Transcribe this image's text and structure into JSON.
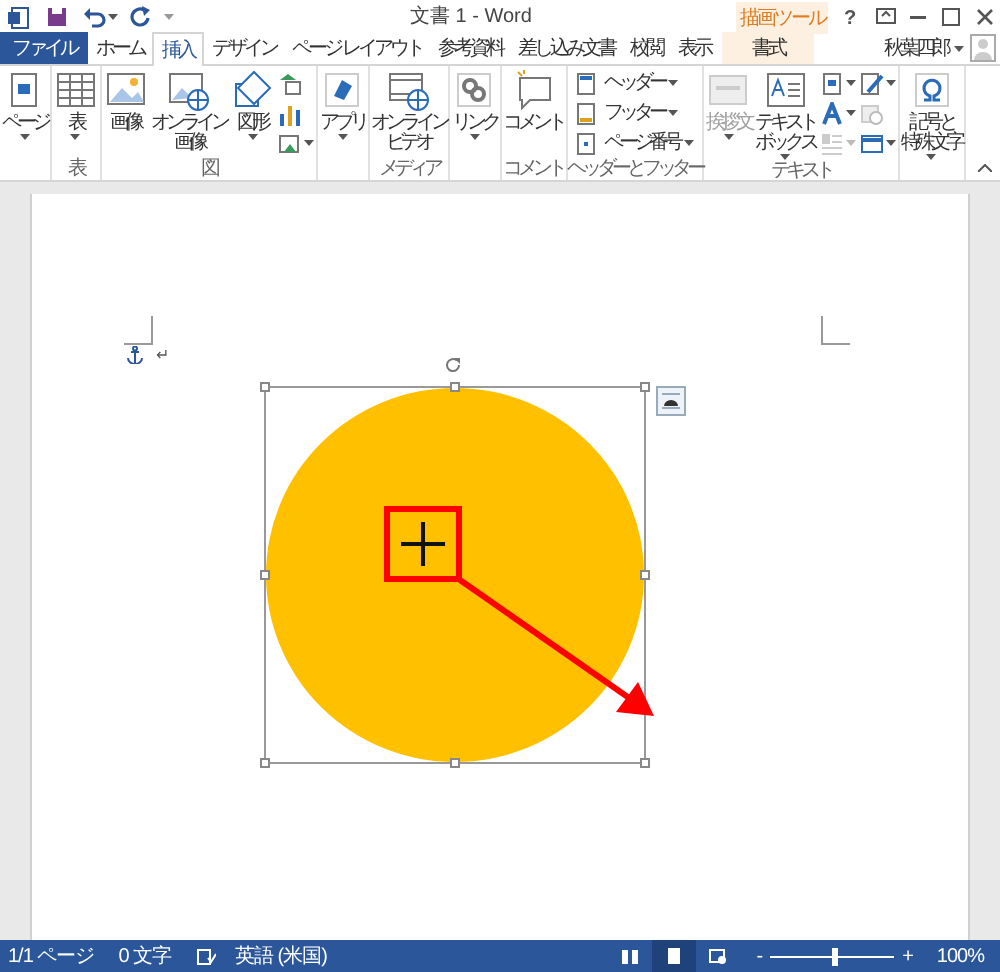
{
  "title_bar": {
    "title": "文書 1 - Word",
    "context_label": "描画ツール",
    "help": "?"
  },
  "tabs": [
    {
      "label": "ファイル",
      "kind": "file",
      "selected": false
    },
    {
      "label": "ホーム",
      "kind": "normal",
      "selected": false
    },
    {
      "label": "挿入",
      "kind": "normal",
      "selected": true
    },
    {
      "label": "デザイン",
      "kind": "normal",
      "selected": false
    },
    {
      "label": "ページ レイアウト",
      "kind": "normal",
      "selected": false
    },
    {
      "label": "参考資料",
      "kind": "normal",
      "selected": false
    },
    {
      "label": "差し込み文書",
      "kind": "normal",
      "selected": false
    },
    {
      "label": "校閲",
      "kind": "normal",
      "selected": false
    },
    {
      "label": "表示",
      "kind": "normal",
      "selected": false
    },
    {
      "label": "書式",
      "kind": "context",
      "selected": false
    }
  ],
  "user": {
    "name": "秋葉四郎"
  },
  "ribbon": {
    "groups": [
      {
        "buttons": [
          {
            "kind": "large",
            "label": "ページ",
            "menu": true,
            "disabled": false
          }
        ]
      },
      {
        "label": "表",
        "buttons": [
          {
            "kind": "large",
            "label": "表",
            "menu": true,
            "disabled": false
          }
        ]
      },
      {
        "label": "図",
        "buttons": [
          {
            "kind": "large",
            "label": "画像",
            "menu": false,
            "disabled": false
          },
          {
            "kind": "large",
            "label": "オンライン画像",
            "menu": false,
            "disabled": false
          },
          {
            "kind": "large",
            "label": "図形",
            "menu": true,
            "disabled": false
          },
          {
            "kind": "column",
            "items": [
              {
                "menu": false,
                "disabled": false
              },
              {
                "menu": false,
                "disabled": false
              },
              {
                "menu": true,
                "disabled": false
              }
            ]
          }
        ]
      },
      {
        "buttons": [
          {
            "kind": "large",
            "label": "アプリ",
            "menu": true,
            "disabled": false
          }
        ]
      },
      {
        "label": "メディア",
        "buttons": [
          {
            "kind": "large",
            "label": "オンラインビデオ",
            "menu": false,
            "disabled": false
          }
        ]
      },
      {
        "buttons": [
          {
            "kind": "large",
            "label": "リンク",
            "menu": true,
            "disabled": false
          }
        ]
      },
      {
        "label": "コメント",
        "buttons": [
          {
            "kind": "large",
            "label": "コメント",
            "menu": false,
            "disabled": false
          }
        ]
      },
      {
        "label": "ヘッダーとフッター",
        "buttons": [
          {
            "kind": "small",
            "items": [
              {
                "label": "ヘッダー",
                "menu": true,
                "disabled": false
              },
              {
                "label": "フッター",
                "menu": true,
                "disabled": false
              },
              {
                "label": "ページ番号",
                "menu": true,
                "disabled": false
              }
            ]
          }
        ]
      },
      {
        "label": "テキスト",
        "buttons": [
          {
            "kind": "large",
            "label": "挨拶文",
            "menu": true,
            "disabled": true
          },
          {
            "kind": "large",
            "label": "テキストボックス",
            "menu": true,
            "disabled": false
          },
          {
            "kind": "column",
            "items": [
              {
                "menu": true,
                "disabled": false
              },
              {
                "menu": true,
                "disabled": false
              },
              {
                "menu": true,
                "disabled": true
              }
            ]
          },
          {
            "kind": "column",
            "items": [
              {
                "menu": true,
                "disabled": false
              },
              {
                "menu": false,
                "disabled": true
              },
              {
                "menu": true,
                "disabled": false
              }
            ]
          }
        ]
      },
      {
        "buttons": [
          {
            "kind": "large",
            "label": "記号と特殊文字",
            "menu": true,
            "disabled": false
          }
        ]
      }
    ]
  },
  "document": {
    "paragraph_mark": "↵",
    "shape": {
      "selected": true
    }
  },
  "status_bar": {
    "page": "1/1 ページ",
    "words": "0 文字",
    "language": "英語 (米国)",
    "views": [
      {
        "selected": false
      },
      {
        "selected": true
      },
      {
        "selected": false
      }
    ],
    "zoom": {
      "minus": "-",
      "plus": "+",
      "level": 0.52,
      "reading": "100%"
    }
  }
}
